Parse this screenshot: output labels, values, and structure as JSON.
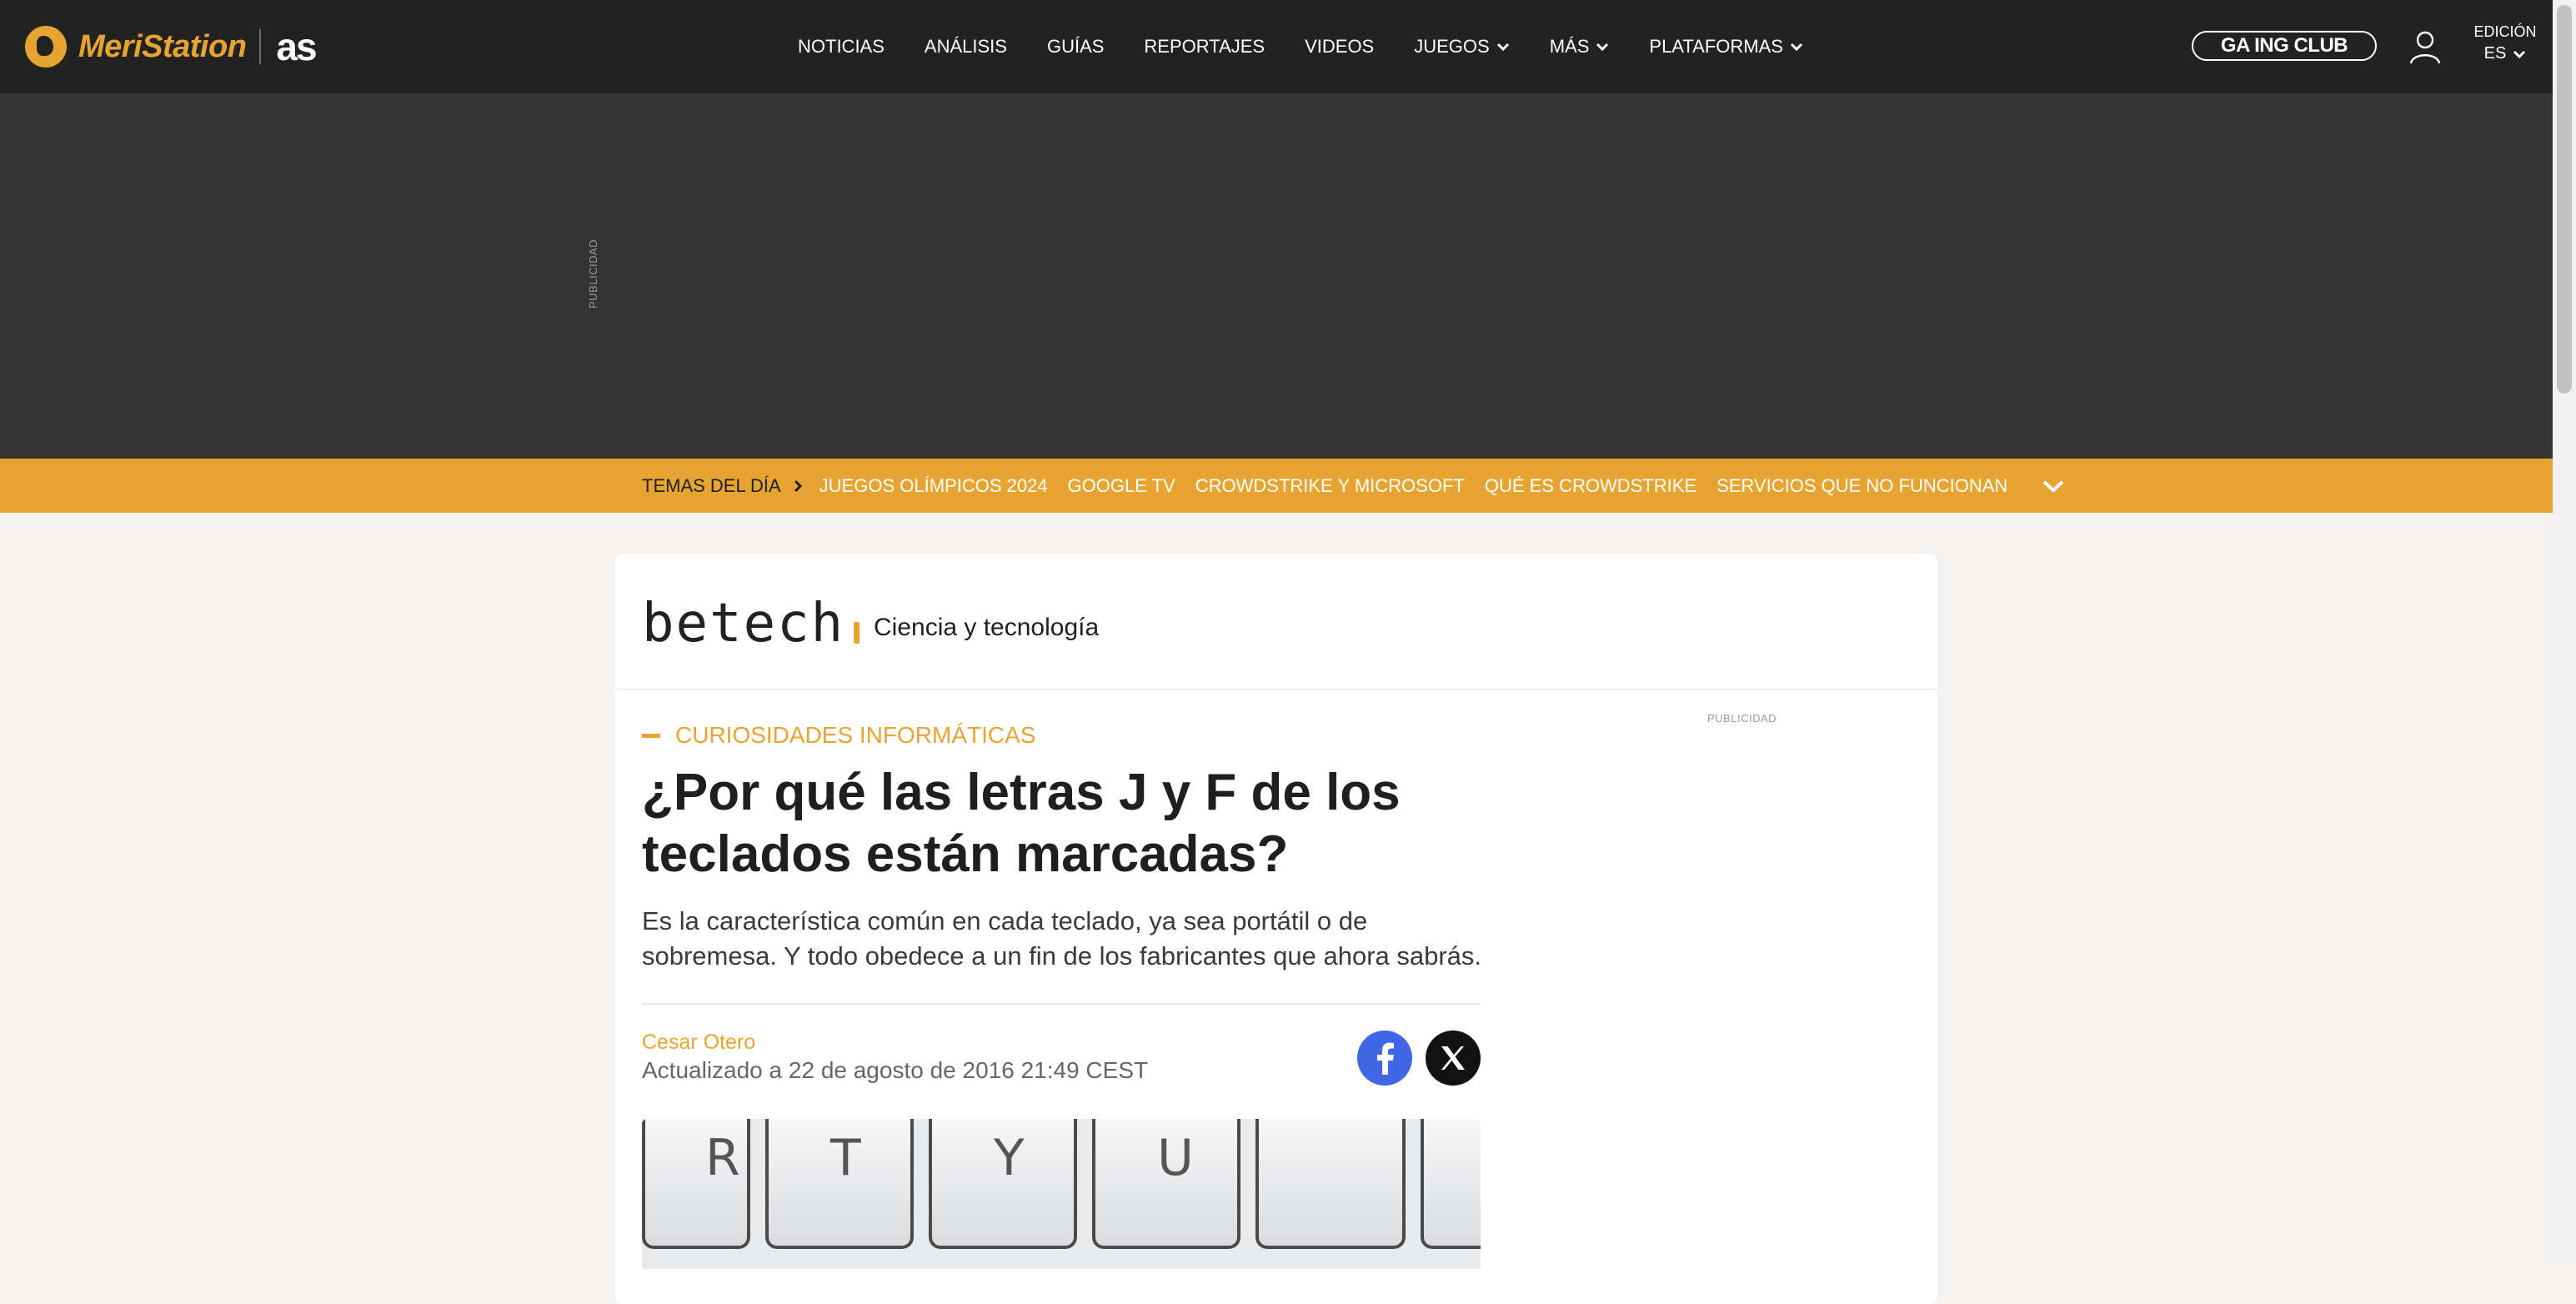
{
  "header": {
    "logo_text": "MeriStation",
    "partner_logo": "as",
    "nav": [
      {
        "label": "NOTICIAS",
        "dropdown": false
      },
      {
        "label": "ANÁLISIS",
        "dropdown": false
      },
      {
        "label": "GUÍAS",
        "dropdown": false
      },
      {
        "label": "REPORTAJES",
        "dropdown": false
      },
      {
        "label": "VIDEOS",
        "dropdown": false
      },
      {
        "label": "JUEGOS",
        "dropdown": true
      },
      {
        "label": "MÁS",
        "dropdown": true
      },
      {
        "label": "PLATAFORMAS",
        "dropdown": true
      }
    ],
    "gaming_club": "GA ING CLUB",
    "edition_label": "EDICIÓN",
    "edition_value": "ES",
    "accent_color": "#e8a431",
    "icons": [
      "meristation-logo-icon",
      "chevron-down-icon",
      "user-icon",
      "controller-icon"
    ]
  },
  "ad_top": {
    "label": "PUBLICIDAD"
  },
  "topics": {
    "heading": "TEMAS DEL DÍA",
    "items": [
      "JUEGOS OLÍMPICOS 2024",
      "GOOGLE TV",
      "CROWDSTRIKE Y MICROSOFT",
      "QUÉ ES CROWDSTRIKE",
      "SERVICIOS QUE NO FUNCIONAN"
    ]
  },
  "section": {
    "logo": "betech",
    "subtitle": "Ciencia y tecnología"
  },
  "article": {
    "kicker": "CURIOSIDADES INFORMÁTICAS",
    "title": "¿Por qué las letras J y F de los teclados están marcadas?",
    "subtitle": "Es la característica común en cada teclado, ya sea portátil o de sobremesa. Y todo obedece a un fin de los fabricantes que ahora sabrás.",
    "author": "Cesar Otero",
    "updated": "Actualizado a 22 de agosto de 2016 21:49 CEST",
    "image_keys": [
      "R",
      "T",
      "Y",
      "U"
    ]
  },
  "ad_side": {
    "label": "PUBLICIDAD"
  }
}
